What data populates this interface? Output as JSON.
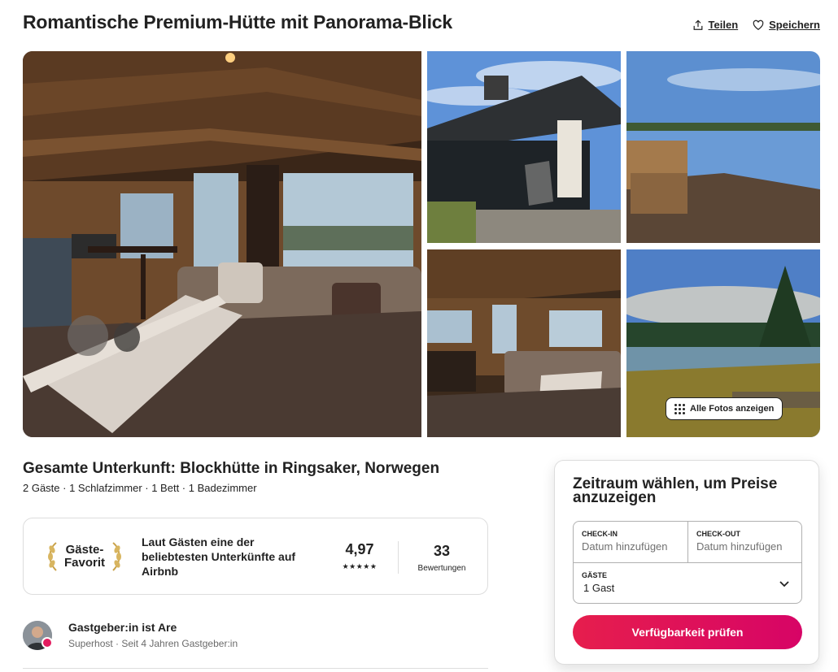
{
  "listing": {
    "title": "Romantische Premium-Hütte mit Panorama-Blick",
    "actions": {
      "share": "Teilen",
      "save": "Speichern"
    },
    "show_all_photos": "Alle Fotos anzeigen",
    "subtitle": "Gesamte Unterkunft: Blockhütte in Ringsaker, Norwegen",
    "details": "2 Gäste · 1 Schlafzimmer · 1 Bett · 1 Badezimmer"
  },
  "guest_favorite": {
    "label_line1": "Gäste-",
    "label_line2": "Favorit",
    "text": "Laut Gästen eine der beliebtesten Unterkünfte auf Airbnb",
    "rating": "4,97",
    "stars": "★★★★★",
    "review_count": "33",
    "review_label": "Bewertungen"
  },
  "host": {
    "name": "Gastgeber:in ist Are",
    "meta": "Superhost · Seit 4 Jahren Gastgeber:in"
  },
  "booking": {
    "title": "Zeitraum wählen, um Preise anzuzeigen",
    "checkin_label": "CHECK-IN",
    "checkin_value": "Datum hinzufügen",
    "checkout_label": "CHECK-OUT",
    "checkout_value": "Datum hinzufügen",
    "guests_label": "GÄSTE",
    "guests_value": "1 Gast",
    "cta": "Verfügbarkeit prüfen"
  },
  "colors": {
    "accent": "#e61e4d",
    "accent_end": "#d70466",
    "border": "#dddddd",
    "muted": "#6a6a6a"
  },
  "icons": [
    "share-icon",
    "heart-icon",
    "grid-dots-icon",
    "laurel-left-icon",
    "laurel-right-icon",
    "chevron-down-icon"
  ]
}
